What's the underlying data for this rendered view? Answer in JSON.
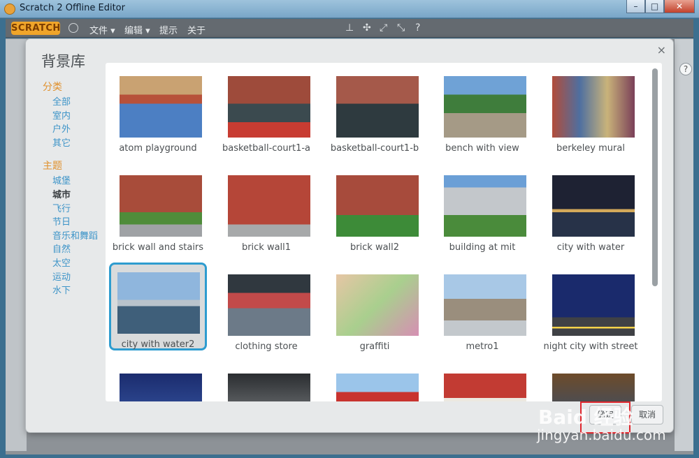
{
  "window": {
    "title": "Scratch 2 Offline Editor",
    "buttons": [
      "–",
      "□",
      "✕"
    ]
  },
  "menubar": {
    "logo": "SCRATCH",
    "menus": [
      "文件 ▾",
      "编辑 ▾",
      "提示",
      "关于"
    ]
  },
  "dialog": {
    "title": "背景库",
    "close": "×",
    "categories_head": "分类",
    "categories": [
      "全部",
      "室内",
      "户外",
      "其它"
    ],
    "themes_head": "主题",
    "themes": [
      "城堡",
      "城市",
      "飞行",
      "节日",
      "音乐和舞蹈",
      "自然",
      "太空",
      "运动",
      "水下"
    ],
    "active_theme": "城市",
    "items": [
      {
        "label": "atom playground"
      },
      {
        "label": "basketball-court1-a"
      },
      {
        "label": "basketball-court1-b"
      },
      {
        "label": "bench with view"
      },
      {
        "label": "berkeley mural"
      },
      {
        "label": "brick wall and stairs"
      },
      {
        "label": "brick wall1"
      },
      {
        "label": "brick wall2"
      },
      {
        "label": "building at mit"
      },
      {
        "label": "city with water"
      },
      {
        "label": "city with water2"
      },
      {
        "label": "clothing store"
      },
      {
        "label": "graffiti"
      },
      {
        "label": "metro1"
      },
      {
        "label": "night city with street"
      },
      {
        "label": ""
      },
      {
        "label": ""
      },
      {
        "label": ""
      },
      {
        "label": ""
      },
      {
        "label": ""
      }
    ],
    "selected_index": 10,
    "ok_button": "确定",
    "cancel_button": "取消"
  },
  "watermark": {
    "main": "Baid 经验",
    "sub": "jingyan.baidu.com"
  },
  "colors": {
    "accent": "#2e9ccf",
    "category_link": "#3d94c8",
    "head": "#e0912e"
  }
}
